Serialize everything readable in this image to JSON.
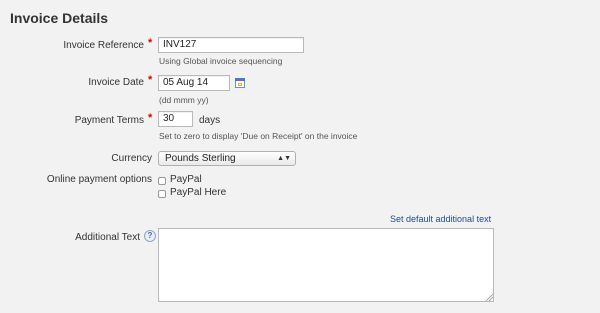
{
  "section": {
    "title": "Invoice Details"
  },
  "invoice_reference": {
    "label": "Invoice Reference",
    "value": "INV127",
    "hint": "Using Global invoice sequencing"
  },
  "invoice_date": {
    "label": "Invoice Date",
    "value": "05 Aug 14",
    "hint": "(dd mmm yy)",
    "icon": "calendar-icon"
  },
  "payment_terms": {
    "label": "Payment Terms",
    "value": "30",
    "unit": "days",
    "hint": "Set to zero to display 'Due on Receipt' on the invoice"
  },
  "currency": {
    "label": "Currency",
    "selected": "Pounds Sterling",
    "arrow": "▲▼"
  },
  "online_payment_options": {
    "label": "Online payment options",
    "options": [
      "PayPal",
      "PayPal Here"
    ]
  },
  "additional_text": {
    "label": "Additional Text",
    "help": "?",
    "default_link": "Set default additional text",
    "value": ""
  }
}
